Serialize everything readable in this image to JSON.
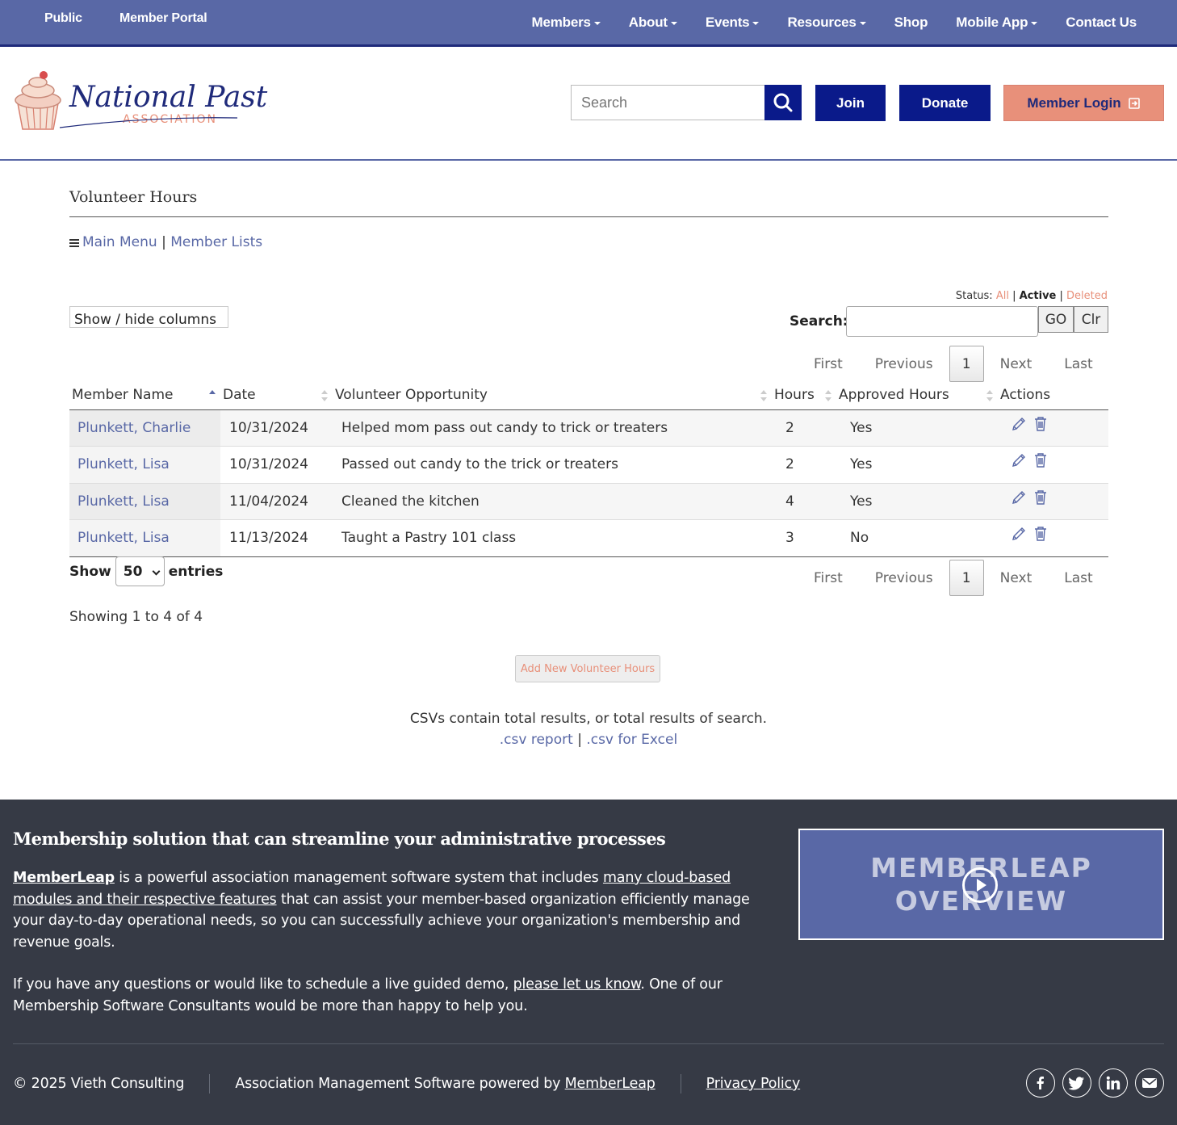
{
  "topbar": {
    "left": [
      "Public",
      "Member Portal"
    ],
    "nav": [
      {
        "label": "Members",
        "dropdown": true
      },
      {
        "label": "About",
        "dropdown": true
      },
      {
        "label": "Events",
        "dropdown": true
      },
      {
        "label": "Resources",
        "dropdown": true
      },
      {
        "label": "Shop",
        "dropdown": false
      },
      {
        "label": "Mobile App",
        "dropdown": true
      },
      {
        "label": "Contact Us",
        "dropdown": false
      }
    ]
  },
  "header": {
    "logo_main": "National Pastries",
    "logo_sub": "ASSOCIATION",
    "search_placeholder": "Search",
    "join": "Join",
    "donate": "Donate",
    "login": "Member Login"
  },
  "main": {
    "title": "Volunteer Hours",
    "crumb_main": "Main Menu",
    "crumb_sep": "|",
    "crumb_lists": "Member Lists",
    "status_label": "Status:",
    "status_all": "All",
    "status_active": "Active",
    "status_deleted": "Deleted",
    "show_hide": "Show / hide columns",
    "search_label": "Search:",
    "go": "GO",
    "clr": "Clr",
    "pager": {
      "first": "First",
      "previous": "Previous",
      "current": "1",
      "next": "Next",
      "last": "Last"
    },
    "columns": [
      "Member Name",
      "Date",
      "Volunteer Opportunity",
      "Hours",
      "Approved Hours",
      "Actions"
    ],
    "rows": [
      {
        "name": "Plunkett, Charlie",
        "date": "10/31/2024",
        "opportunity": "Helped mom pass out candy to trick or treaters",
        "hours": "2",
        "approved": "Yes"
      },
      {
        "name": "Plunkett, Lisa",
        "date": "10/31/2024",
        "opportunity": "Passed out candy to the trick or treaters",
        "hours": "2",
        "approved": "Yes"
      },
      {
        "name": "Plunkett, Lisa",
        "date": "11/04/2024",
        "opportunity": "Cleaned the kitchen",
        "hours": "4",
        "approved": "Yes"
      },
      {
        "name": "Plunkett, Lisa",
        "date": "11/13/2024",
        "opportunity": "Taught a Pastry 101 class",
        "hours": "3",
        "approved": "No"
      }
    ],
    "show_label": "Show",
    "entries_value": "50",
    "entries_label": "entries",
    "showing": "Showing 1 to 4 of 4",
    "add_button": "Add New Volunteer Hours",
    "csv_note": "CSVs contain total results, or total results of search.",
    "csv_report": ".csv report",
    "csv_sep": "|",
    "csv_excel": ".csv for Excel"
  },
  "footer": {
    "title": "Membership solution that can streamline your administrative processes",
    "p1_link1": "MemberLeap",
    "p1_text1": " is a powerful association management software system that includes ",
    "p1_link2": "many cloud-based modules and their respective features",
    "p1_text2": " that can assist your member-based organization efficiently manage your day-to-day operational needs, so you can successfully achieve your organization's membership and revenue goals.",
    "p2_text1": "If you have any questions or would like to schedule a live guided demo, ",
    "p2_link": "please let us know",
    "p2_text2": ". One of our Membership Software Consultants would be more than happy to help you.",
    "video_line1": "MEMBERLEAP",
    "video_line2": "OVERVIEW",
    "copyright": "© 2025 Vieth Consulting",
    "powered_text": "Association Management Software powered by ",
    "powered_link": "MemberLeap",
    "privacy": "Privacy Policy",
    "socials": [
      "facebook-icon",
      "twitter-icon",
      "linkedin-icon",
      "email-icon"
    ]
  },
  "colors": {
    "nav": "#5968a6",
    "navy": "#0a1a8a",
    "accent": "#e8907a",
    "footer": "#363a45"
  }
}
